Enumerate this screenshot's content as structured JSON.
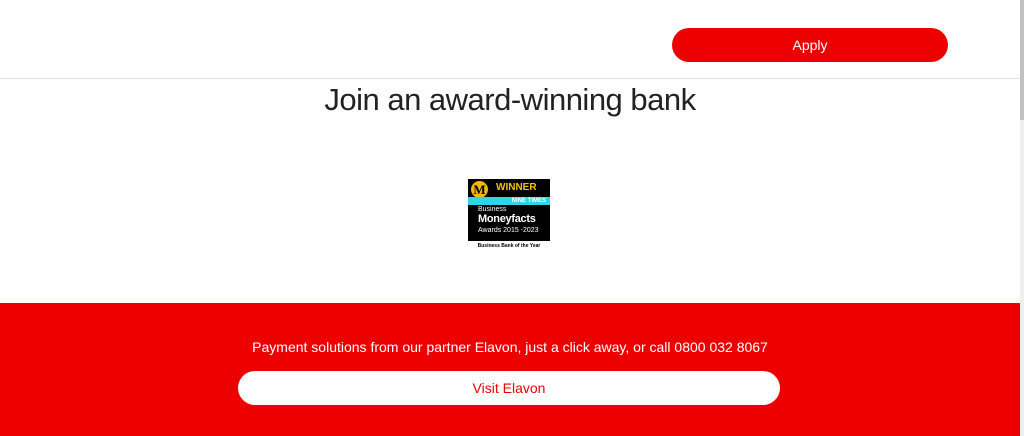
{
  "topbar": {
    "apply_label": "Apply"
  },
  "main": {
    "heading": "Join an award-winning bank",
    "award": {
      "logo_letter": "M",
      "winner": "WINNER",
      "band": "NINE TIMES",
      "line1": "Business",
      "line2": "Moneyfacts",
      "line3": "Awards 2015 -2023",
      "caption": "Business Bank of the Year"
    }
  },
  "partner": {
    "text": "Payment solutions from our partner Elavon, just a click away, or call 0800 032 8067",
    "visit_label": "Visit Elavon"
  },
  "colors": {
    "brand_red": "#ec0000",
    "heading_text": "#222222",
    "award_gold": "#f2c500",
    "award_cyan": "#2fd4e6"
  }
}
